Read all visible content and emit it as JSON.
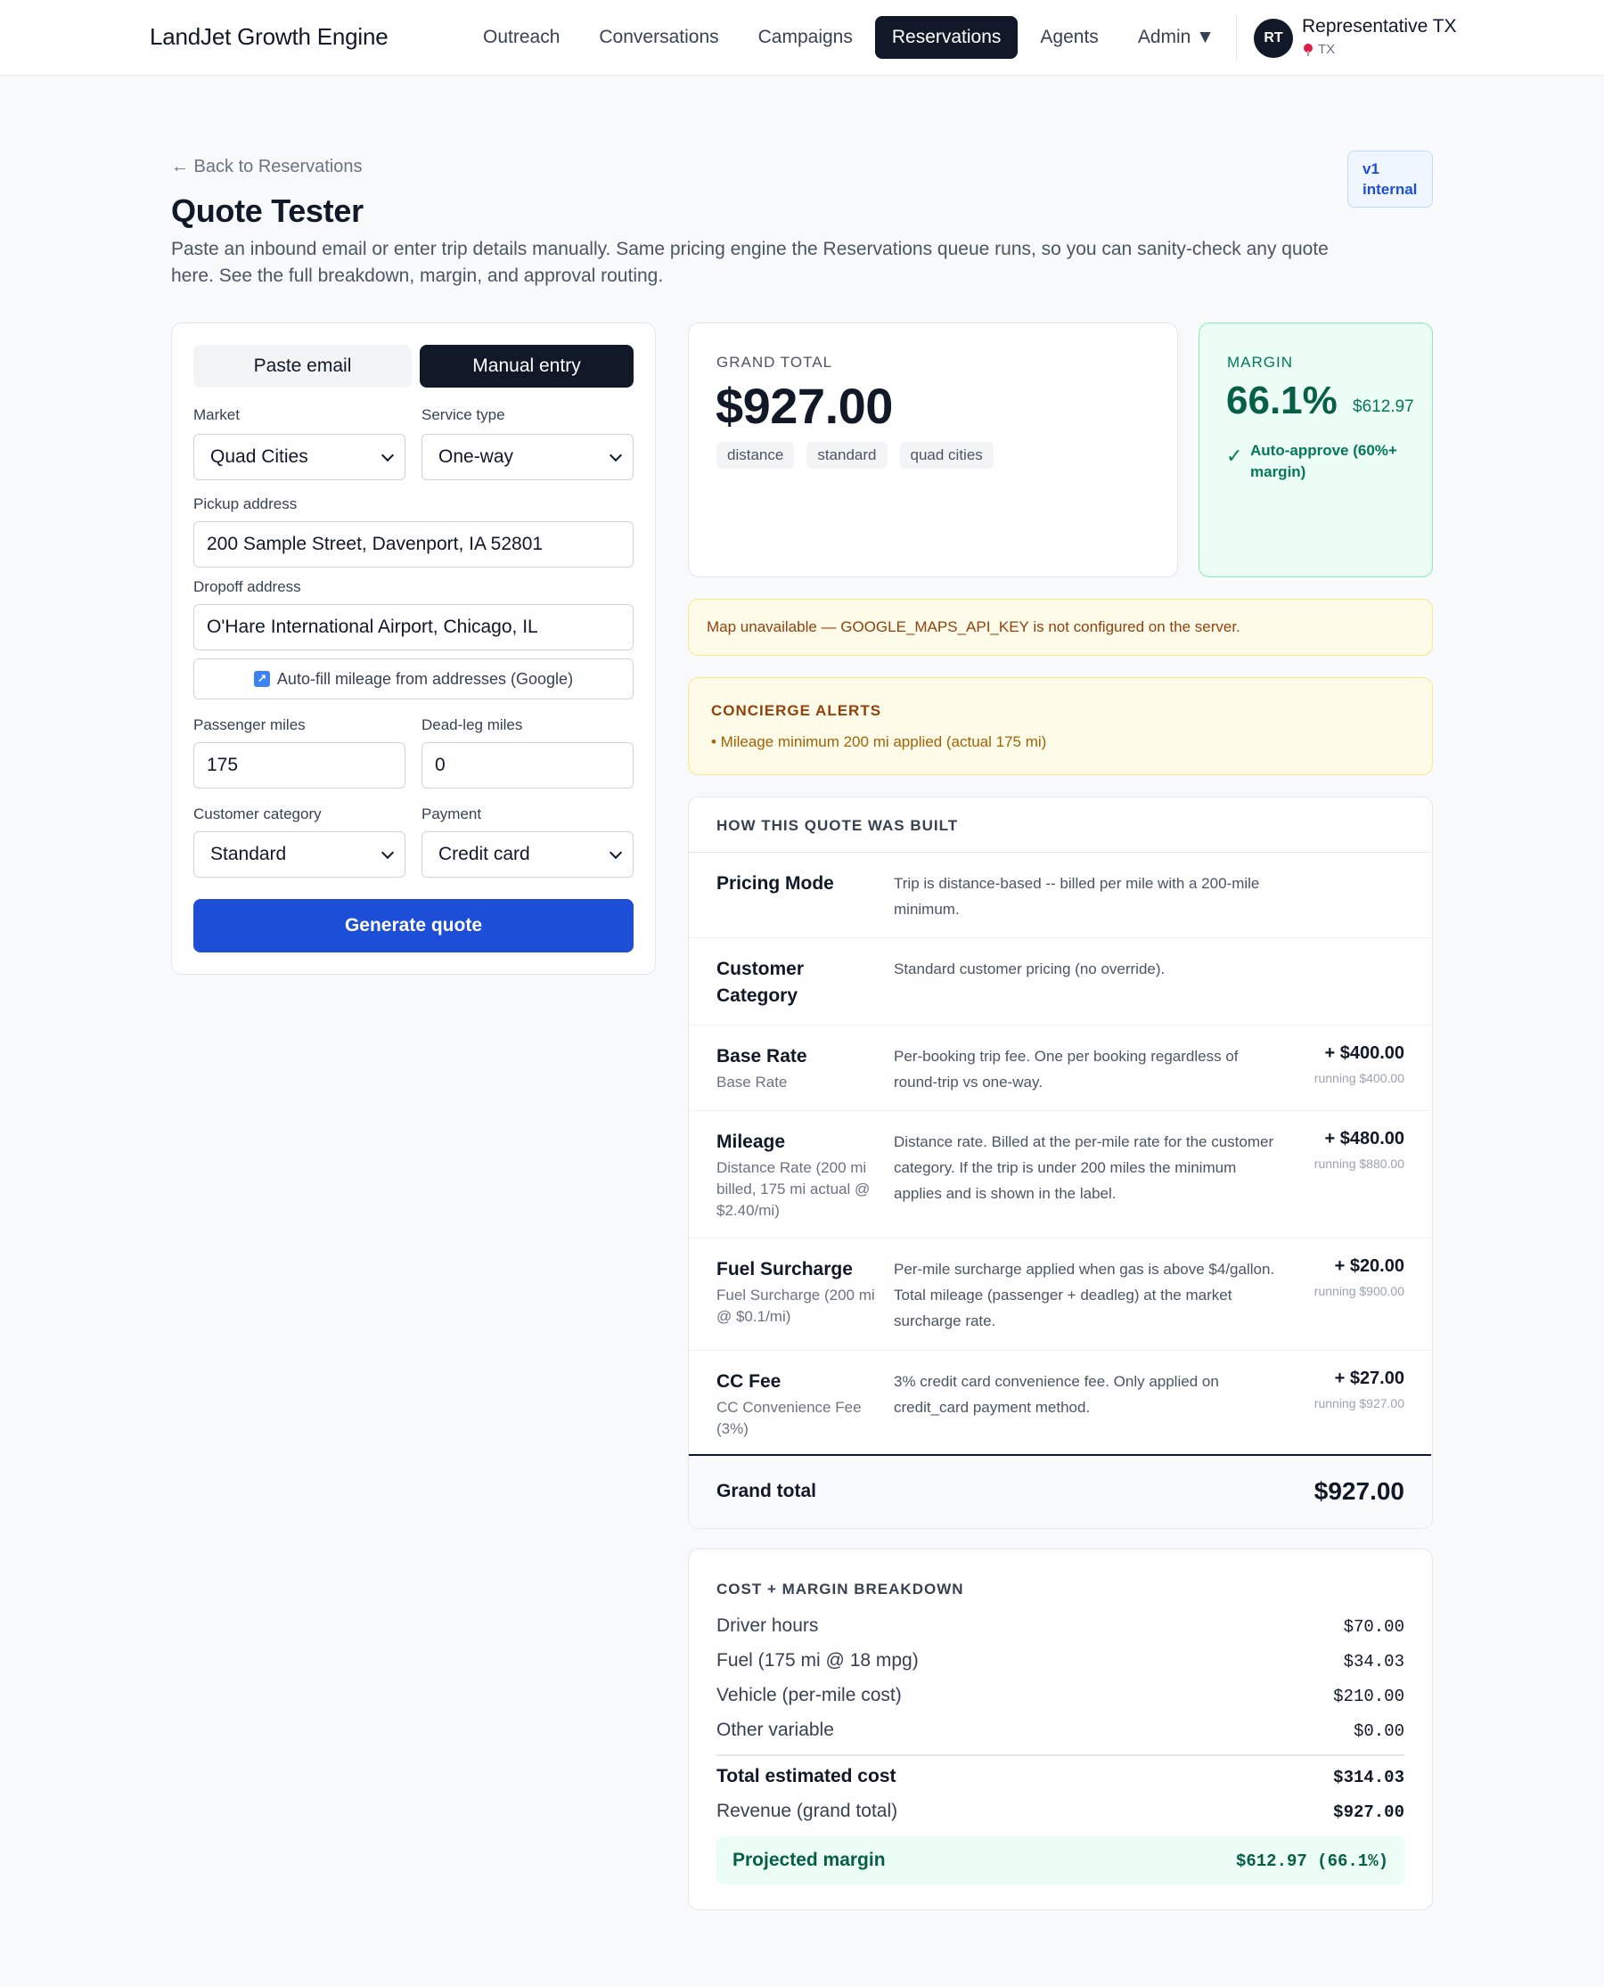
{
  "nav": {
    "brand": "LandJet Growth Engine",
    "links": [
      "Outreach",
      "Conversations",
      "Campaigns",
      "Reservations",
      "Agents",
      "Admin ▼"
    ],
    "active": "Reservations",
    "user": {
      "initials": "RT",
      "name": "Representative TX",
      "location": "TX"
    }
  },
  "header": {
    "back": "← Back to Reservations",
    "title": "Quote Tester",
    "description": "Paste an inbound email or enter trip details manually. Same pricing engine the Reservations queue runs, so you can sanity-check any quote here. See the full breakdown, margin, and approval routing.",
    "badge_line1": "v1",
    "badge_line2": "internal"
  },
  "form": {
    "tab_paste": "Paste email",
    "tab_manual": "Manual entry",
    "market_label": "Market",
    "market_value": "Quad Cities",
    "service_label": "Service type",
    "service_value": "One-way",
    "pickup_label": "Pickup address",
    "pickup_value": "200 Sample Street, Davenport, IA 52801",
    "dropoff_label": "Dropoff address",
    "dropoff_value": "O'Hare International Airport, Chicago, IL",
    "autofill_label": "Auto-fill mileage from addresses (Google)",
    "pax_miles_label": "Passenger miles",
    "pax_miles_value": "175",
    "deadleg_label": "Dead-leg miles",
    "deadleg_value": "0",
    "category_label": "Customer category",
    "category_value": "Standard",
    "payment_label": "Payment",
    "payment_value": "Credit card",
    "generate_label": "Generate quote"
  },
  "total": {
    "label": "GRAND TOTAL",
    "amount": "$927.00",
    "tags": [
      "distance",
      "standard",
      "quad cities"
    ]
  },
  "margin": {
    "label": "MARGIN",
    "pct": "66.1%",
    "amount": "$612.97",
    "approval": "Auto-approve (60%+ margin)"
  },
  "map_warning": "Map unavailable — GOOGLE_MAPS_API_KEY is not configured on the server.",
  "alerts": {
    "title": "CONCIERGE ALERTS",
    "items": [
      "• Mileage minimum 200 mi applied (actual 175 mi)"
    ]
  },
  "build": {
    "title": "HOW THIS QUOTE WAS BUILT",
    "rows": [
      {
        "name": "Pricing Mode",
        "sub": "",
        "desc": "Trip is distance-based -- billed per mile with a 200-mile minimum.",
        "amount": "",
        "running": ""
      },
      {
        "name": "Customer Category",
        "sub": "",
        "desc": "Standard customer pricing (no override).",
        "amount": "",
        "running": ""
      },
      {
        "name": "Base Rate",
        "sub": "Base Rate",
        "desc": "Per-booking trip fee. One per booking regardless of round-trip vs one-way.",
        "amount": "+ $400.00",
        "running": "running $400.00"
      },
      {
        "name": "Mileage",
        "sub": "Distance Rate (200 mi billed, 175 mi actual @ $2.40/mi)",
        "desc": "Distance rate. Billed at the per-mile rate for the customer category. If the trip is under 200 miles the minimum applies and is shown in the label.",
        "amount": "+ $480.00",
        "running": "running $880.00"
      },
      {
        "name": "Fuel Surcharge",
        "sub": "Fuel Surcharge (200 mi @ $0.1/mi)",
        "desc": "Per-mile surcharge applied when gas is above $4/gallon. Total mileage (passenger + deadleg) at the market surcharge rate.",
        "amount": "+ $20.00",
        "running": "running $900.00"
      },
      {
        "name": "CC Fee",
        "sub": "CC Convenience Fee (3%)",
        "desc": "3% credit card convenience fee. Only applied on credit_card payment method.",
        "amount": "+ $27.00",
        "running": "running $927.00"
      }
    ],
    "grand_total_label": "Grand total",
    "grand_total_amount": "$927.00"
  },
  "cost": {
    "title": "COST + MARGIN BREAKDOWN",
    "rows": [
      {
        "label": "Driver hours",
        "value": "$70.00"
      },
      {
        "label": "Fuel (175 mi @ 18 mpg)",
        "value": "$34.03"
      },
      {
        "label": "Vehicle (per-mile cost)",
        "value": "$210.00"
      },
      {
        "label": "Other variable",
        "value": "$0.00"
      }
    ],
    "total_cost_label": "Total estimated cost",
    "total_cost_value": "$314.03",
    "revenue_label": "Revenue (grand total)",
    "revenue_value": "$927.00",
    "projected_label": "Projected margin",
    "projected_value": "$612.97 (66.1%)"
  }
}
